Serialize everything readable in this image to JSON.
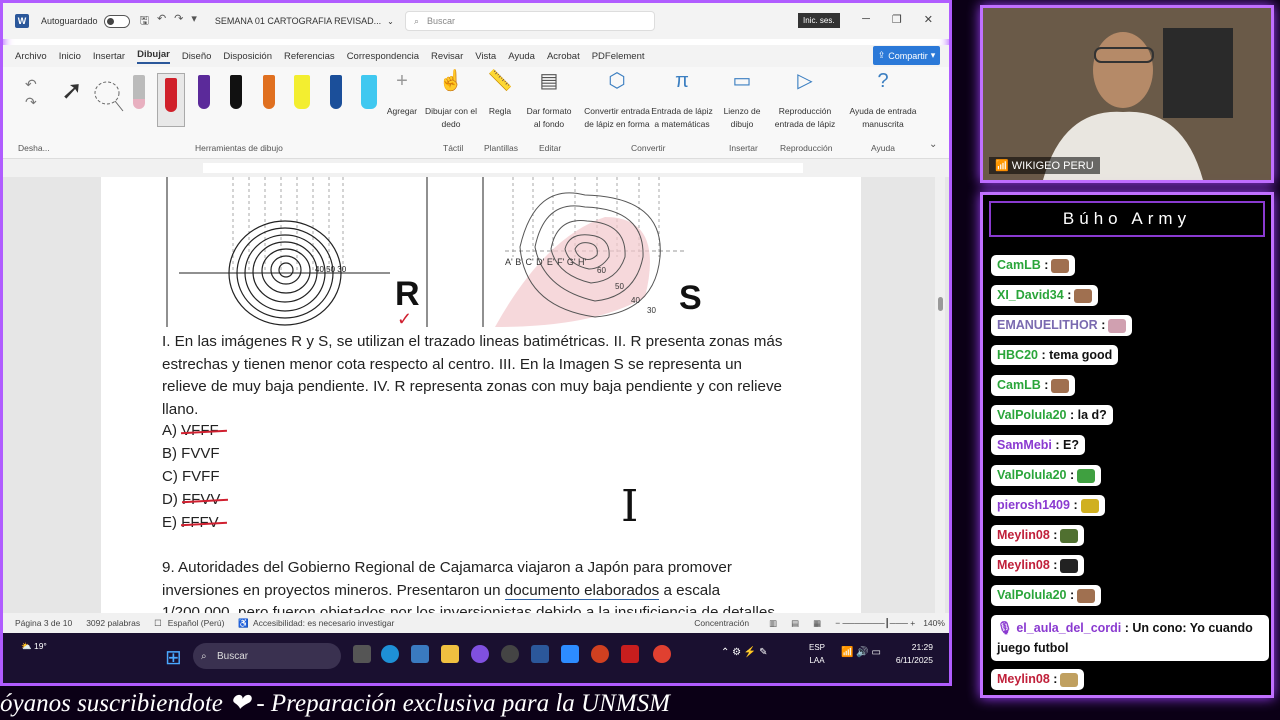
{
  "word": {
    "autosave_label": "Autoguardado",
    "doc_title": "SEMANA 01 CARTOGRAFIA REVISAD...",
    "search_placeholder": "Buscar",
    "signin": "Inic. ses.",
    "menu": [
      "Archivo",
      "Inicio",
      "Insertar",
      "Dibujar",
      "Diseño",
      "Disposición",
      "Referencias",
      "Correspondencia",
      "Revisar",
      "Vista",
      "Ayuda",
      "Acrobat",
      "PDFelement"
    ],
    "share": "Compartir",
    "ribbon": {
      "undo_label": "Desha...",
      "tools_group": "Herramientas de dibujo",
      "add_label": "Agregar",
      "draw_finger": "Dibujar con el dedo",
      "ruler": "Regla",
      "format_bg": "Dar formato al fondo",
      "ink_to_shape": "Convertir entrada de lápiz en forma",
      "ink_math": "Entrada de lápiz a matemáticas",
      "canvas": "Lienzo de dibujo",
      "replay": "Reproducción entrada de lápiz",
      "help_ink": "Ayuda de entrada manuscrita",
      "g_tactil": "Táctil",
      "g_plantillas": "Plantillas",
      "g_editar": "Editar",
      "g_convertir": "Convertir",
      "g_insertar": "Insertar",
      "g_reproduccion": "Reproducción",
      "g_ayuda": "Ayuda"
    },
    "figure_labels": {
      "r": "R",
      "s": "S",
      "ticks_left": "40 50 30",
      "ticks_right": "A' B' C' D' E' F' G' H'",
      "v60": "60",
      "v50": "50",
      "v40": "40",
      "v30": "30"
    },
    "q1_lines": [
      "I. En las imágenes R y S, se utilizan el trazado lineas batimétricas. II. R presenta zonas más",
      "estrechas y tienen menor cota respecto al centro. III. En la Imagen S se representa un",
      "relieve de muy baja pendiente. IV. R representa zonas con muy baja pendiente y con relieve",
      "llano."
    ],
    "options": [
      {
        "letter": "A) ",
        "text": "VFFF"
      },
      {
        "letter": "B) ",
        "text": "FVVF"
      },
      {
        "letter": "C) ",
        "text": "FVFF"
      },
      {
        "letter": "D) ",
        "text": "FFVV"
      },
      {
        "letter": "E) ",
        "text": "FFFV"
      }
    ],
    "q9_line1": "9. Autoridades del Gobierno Regional de Cajamarca viajaron a Japón para promover",
    "q9_line2a": "inversiones en proyectos mineros. Presentaron un ",
    "q9_line2b": "documento elaborados",
    "q9_line2c": " a escala",
    "q9_line3": "1/200 000, pero fueron objetados por los inversionistas debido a la insuficiencia de detalles",
    "status": {
      "page": "Página 3 de 10",
      "words": "3092 palabras",
      "lang": "Español (Perú)",
      "access": "Accesibilidad: es necesario investigar",
      "focus": "Concentración",
      "zoom": "140%"
    }
  },
  "taskbar": {
    "temp": "19°",
    "search": "Buscar",
    "lang1": "ESP",
    "lang2": "LAA",
    "time": "21:29",
    "date": "6/11/2025"
  },
  "ticker": "óyanos suscribiendote   ❤   -   Preparación exclusiva para la UNMSM",
  "cam": {
    "label": "WIKIGEO PERU"
  },
  "chat": {
    "title": "Búho Army",
    "messages": [
      {
        "user": "CamLB",
        "text": ":",
        "color": "#2aa53a",
        "emote": "#a07050"
      },
      {
        "user": "XI_David34",
        "text": ":",
        "color": "#2aa53a",
        "emote": "#a07050"
      },
      {
        "user": "EMANUELITHOR",
        "text": ":",
        "color": "#7a6ab0",
        "emote": "#d0a0b0"
      },
      {
        "user": "HBC20",
        "text": ": tema good",
        "color": "#2aa53a",
        "emote": ""
      },
      {
        "user": "CamLB",
        "text": ":",
        "color": "#2aa53a",
        "emote": "#a07050"
      },
      {
        "user": "ValPolula20",
        "text": ": la d?",
        "color": "#2aa53a",
        "emote": ""
      },
      {
        "user": "SamMebi",
        "text": ": E?",
        "color": "#8a3ad0",
        "emote": ""
      },
      {
        "user": "ValPolula20",
        "text": ":",
        "color": "#2aa53a",
        "emote": "#3fa040"
      },
      {
        "user": "pierosh1409",
        "text": ":",
        "color": "#8a3ad0",
        "emote": "#d0b020"
      },
      {
        "user": "Meylin08",
        "text": ":",
        "color": "#c0203a",
        "emote": "#507030"
      },
      {
        "user": "Meylin08",
        "text": ":",
        "color": "#c0203a",
        "emote": "#222222"
      },
      {
        "user": "ValPolula20",
        "text": ":",
        "color": "#2aa53a",
        "emote": "#a07050"
      }
    ],
    "long_msg_user": "el_aula_del_cordi",
    "long_msg_text": ": Un cono: Yo cuando juego futbol",
    "last_user": "Meylin08",
    "last_text": ":"
  }
}
